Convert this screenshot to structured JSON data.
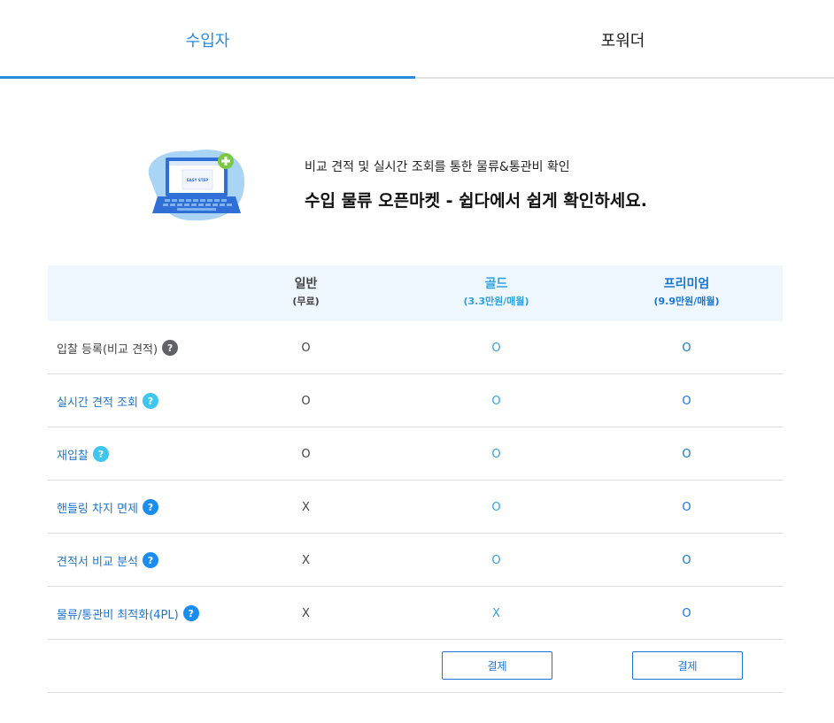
{
  "tabs": [
    {
      "label": "수입자",
      "active": true
    },
    {
      "label": "포워더",
      "active": false
    }
  ],
  "hero": {
    "illustration_text": "EASY STEP",
    "subtitle": "비교 견적 및 실시간 조회를 통한 물류&통관비 확인",
    "title": "수입 물류 오픈마켓 - 쉽다에서 쉽게 확인하세요."
  },
  "plans": [
    {
      "name": "일반",
      "price": "(무료)"
    },
    {
      "name": "골드",
      "price": "(3.3만원/매월)"
    },
    {
      "name": "프리미엄",
      "price": "(9.9만원/매월)"
    }
  ],
  "features": [
    {
      "label": "입찰 등록(비교 견적)",
      "values": [
        "O",
        "O",
        "O"
      ]
    },
    {
      "label": "실시간 견적 조회",
      "values": [
        "O",
        "O",
        "O"
      ]
    },
    {
      "label": "재입찰",
      "values": [
        "O",
        "O",
        "O"
      ]
    },
    {
      "label": "핸들링 차지 면제",
      "values": [
        "X",
        "O",
        "O"
      ]
    },
    {
      "label": "견적서 비교 분석",
      "values": [
        "X",
        "O",
        "O"
      ]
    },
    {
      "label": "물류/통관비 최적화(4PL)",
      "values": [
        "X",
        "X",
        "O"
      ]
    }
  ],
  "help_icon_glyph": "?",
  "pay_button_label": "결제",
  "colors": {
    "accent": "#2a8bd8",
    "gold": "#29a3e0",
    "premium": "#1a76d2",
    "header_bg": "#eef6fe"
  }
}
